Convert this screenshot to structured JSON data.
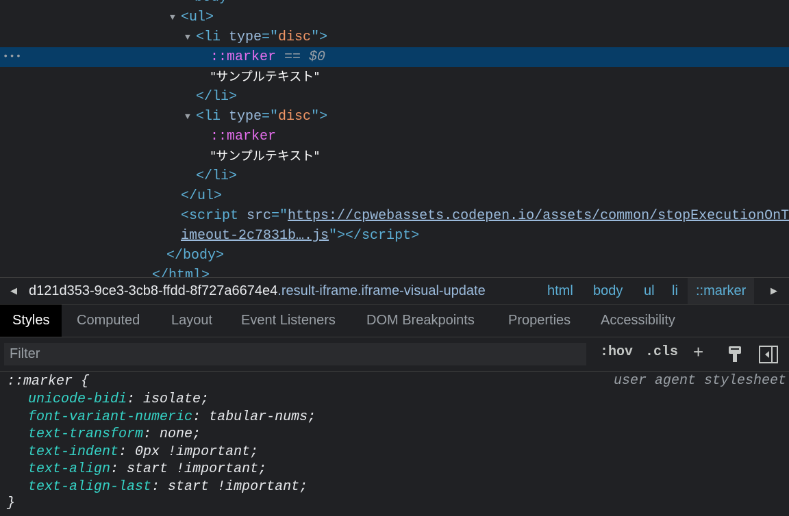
{
  "dom_tree": {
    "lines": [
      {
        "indent": 284,
        "tokens": [
          {
            "c": "tag",
            "t": "body"
          }
        ]
      },
      {
        "indent": 264,
        "triangle": true,
        "tokens": [
          {
            "c": "tag",
            "t": "<ul>"
          }
        ]
      },
      {
        "indent": 286,
        "triangle": true,
        "tokens": [
          {
            "c": "tag",
            "t": "<li "
          },
          {
            "c": "attr",
            "t": "type"
          },
          {
            "c": "tag",
            "t": "=\""
          },
          {
            "c": "val",
            "t": "disc"
          },
          {
            "c": "tag",
            "t": "\">"
          }
        ]
      },
      {
        "indent": 307,
        "selected": true,
        "tokens": [
          {
            "c": "pseudo",
            "t": "::marker"
          },
          {
            "c": "eq",
            "t": " == "
          },
          {
            "c": "dollar",
            "t": "$0"
          }
        ]
      },
      {
        "indent": 307,
        "tokens": [
          {
            "c": "txt",
            "t": "\"サンプルテキスト\""
          }
        ]
      },
      {
        "indent": 286,
        "tokens": [
          {
            "c": "tag",
            "t": "</li>"
          }
        ]
      },
      {
        "indent": 286,
        "triangle": true,
        "tokens": [
          {
            "c": "tag",
            "t": "<li "
          },
          {
            "c": "attr",
            "t": "type"
          },
          {
            "c": "tag",
            "t": "=\""
          },
          {
            "c": "val",
            "t": "disc"
          },
          {
            "c": "tag",
            "t": "\">"
          }
        ]
      },
      {
        "indent": 307,
        "tokens": [
          {
            "c": "pseudo",
            "t": "::marker"
          }
        ]
      },
      {
        "indent": 307,
        "tokens": [
          {
            "c": "txt",
            "t": "\"サンプルテキスト\""
          }
        ]
      },
      {
        "indent": 286,
        "tokens": [
          {
            "c": "tag",
            "t": "</li>"
          }
        ]
      },
      {
        "indent": 264,
        "tokens": [
          {
            "c": "tag",
            "t": "</ul>"
          }
        ]
      },
      {
        "indent": 264,
        "tokens": [
          {
            "c": "tag",
            "t": "<script "
          },
          {
            "c": "attr",
            "t": "src"
          },
          {
            "c": "tag",
            "t": "=\""
          },
          {
            "c": "link",
            "t": "https://cpwebassets.codepen.io/assets/common/stopExecutionOnT"
          }
        ]
      },
      {
        "indent": 264,
        "tokens": [
          {
            "c": "link",
            "t": "imeout-2c7831b….js"
          },
          {
            "c": "tag",
            "t": "\"></script>"
          }
        ]
      },
      {
        "indent": 243,
        "tokens": [
          {
            "c": "tag",
            "t": "</body>"
          }
        ]
      },
      {
        "indent": 222,
        "tokens": [
          {
            "c": "tag",
            "t": "</html>"
          }
        ]
      }
    ],
    "more_icon": "ellipsis-icon"
  },
  "breadcrumb": {
    "first_id": "d121d353-9ce3-3cb8-ffdd-8f727a6674e4",
    "first_class": ".result-iframe.iframe-visual-update",
    "items": [
      "html",
      "body",
      "ul",
      "li",
      "::marker"
    ]
  },
  "tabs": [
    "Styles",
    "Computed",
    "Layout",
    "Event Listeners",
    "DOM Breakpoints",
    "Properties",
    "Accessibility"
  ],
  "active_tab": "Styles",
  "filter": {
    "placeholder": "Filter",
    "value": "",
    "hov": ":hov",
    "cls": ".cls",
    "plus": "+"
  },
  "styles": {
    "selector": "::marker {",
    "source": "user agent stylesheet",
    "declarations": [
      {
        "prop": "unicode-bidi",
        "value": "isolate;"
      },
      {
        "prop": "font-variant-numeric",
        "value": "tabular-nums;"
      },
      {
        "prop": "text-transform",
        "value": "none;"
      },
      {
        "prop": "text-indent",
        "value": "0px !important;"
      },
      {
        "prop": "text-align",
        "value": "start !important;"
      },
      {
        "prop": "text-align-last",
        "value": "start !important;"
      }
    ],
    "close": "}"
  },
  "colors": {
    "selection": "#073d67",
    "tag": "#5db0d7",
    "attr_value": "#f29766",
    "pseudo": "#e36eec",
    "css_property": "#35d4c7"
  }
}
